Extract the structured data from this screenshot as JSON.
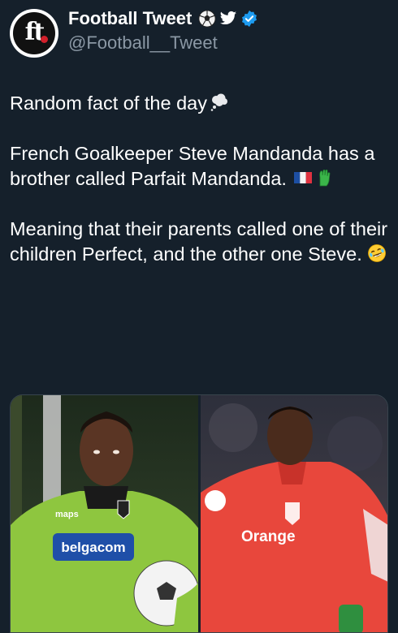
{
  "account": {
    "display_name": "Football Tweet",
    "handle": "@Football__Tweet",
    "avatar_text": "ft",
    "name_icons": [
      "soccer-ball-icon",
      "twitter-bird-icon",
      "verified-badge-icon"
    ]
  },
  "tweet": {
    "line1": "Random fact of the day",
    "line1_emoji": "thought-bubble-emoji",
    "para2": "French Goalkeeper Steve Mandanda has a brother called Parfait Mandanda.",
    "para2_emojis": [
      "france-flag-emoji",
      "gloves-emoji"
    ],
    "para3": "Meaning that their parents called one of their children Perfect, and the other one Steve.",
    "para3_emoji": "laughing-emoji"
  },
  "media": {
    "left_sponsor": "belgacom",
    "left_brand": "maps",
    "right_sponsor": "Orange"
  },
  "colors": {
    "background": "#15202b",
    "text": "#e7e9ea",
    "secondary": "#8b98a5",
    "verified": "#1d9bf0"
  }
}
